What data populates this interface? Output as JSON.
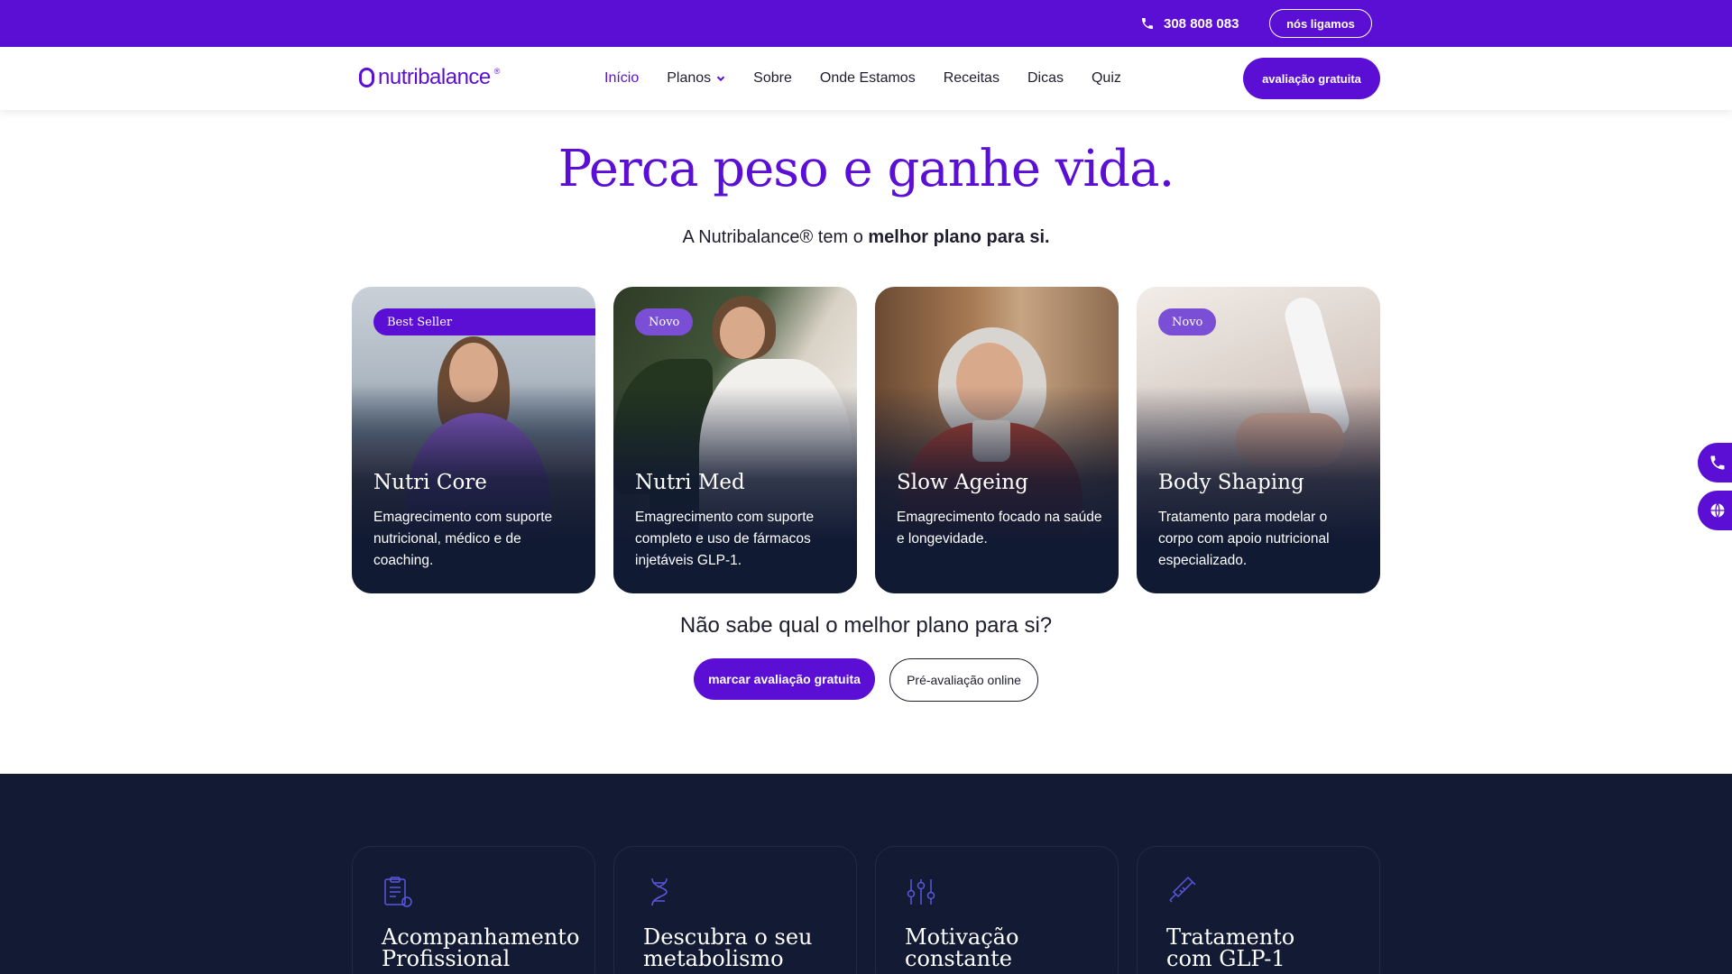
{
  "topbar": {
    "phone": "308 808 083",
    "callback_label": "nós ligamos"
  },
  "nav": {
    "logo_text": "nutribalance",
    "items": [
      {
        "label": "Início",
        "active": true
      },
      {
        "label": "Planos",
        "dropdown": true
      },
      {
        "label": "Sobre"
      },
      {
        "label": "Onde Estamos"
      },
      {
        "label": "Receitas"
      },
      {
        "label": "Dicas"
      },
      {
        "label": "Quiz"
      }
    ],
    "cta_label": "avaliação gratuita"
  },
  "hero": {
    "title": "Perca peso e ganhe vida.",
    "subtitle_prefix": "A Nutribalance® tem o ",
    "subtitle_bold": "melhor plano para si."
  },
  "plans": [
    {
      "badge": "Best Seller",
      "name": "Nutri Core",
      "description": "Emagrecimento com suporte nutricional, médico e de coaching."
    },
    {
      "badge": "Novo",
      "name": "Nutri Med",
      "description": "Emagrecimento com suporte completo e uso de fármacos injetáveis GLP-1."
    },
    {
      "badge": "",
      "name": "Slow Ageing",
      "description": "Emagrecimento focado na saúde e longevidade."
    },
    {
      "badge": "Novo",
      "name": "Body Shaping",
      "description": "Tratamento para modelar o corpo com apoio nutricional especializado."
    }
  ],
  "help": {
    "question": "Não sabe qual o melhor plano para si?",
    "primary_button": "marcar avaliação gratuita",
    "secondary_button": "Pré-avaliação online"
  },
  "features": [
    {
      "icon": "clipboard-apple-icon",
      "title_line1": "Acompanhamento",
      "title_line2": "Profissional"
    },
    {
      "icon": "dna-icon",
      "title_line1": "Descubra o seu",
      "title_line2": "metabolismo"
    },
    {
      "icon": "sliders-icon",
      "title_line1": "Motivação",
      "title_line2": "constante"
    },
    {
      "icon": "syringe-icon",
      "title_line1": "Tratamento",
      "title_line2": "com GLP-1"
    }
  ],
  "colors": {
    "brand": "#5b0fd4",
    "dark_section": "#121b33",
    "badge_soft": "#7a4fd6"
  }
}
